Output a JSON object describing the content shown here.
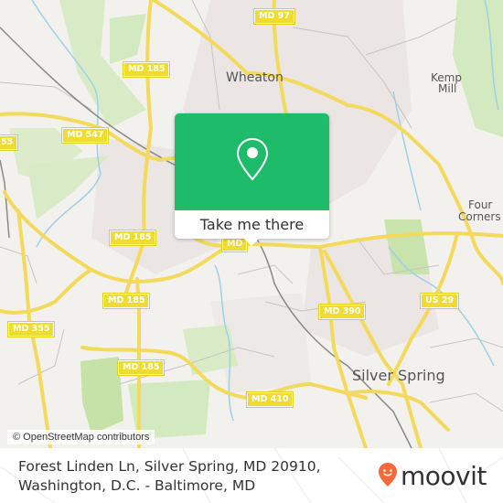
{
  "map": {
    "road_shields": [
      {
        "id": "md97",
        "label": "MD 97"
      },
      {
        "id": "md185-a",
        "label": "MD 185"
      },
      {
        "id": "md547",
        "label": "MD 547"
      },
      {
        "id": "md355-top",
        "label": "55"
      },
      {
        "id": "md185-b",
        "label": "MD 185"
      },
      {
        "id": "md185-c",
        "label": "MD 185"
      },
      {
        "id": "md355",
        "label": "MD 355"
      },
      {
        "id": "md185-d",
        "label": "MD 185"
      },
      {
        "id": "md390",
        "label": "MD 390"
      },
      {
        "id": "us29",
        "label": "US 29"
      },
      {
        "id": "md410",
        "label": "MD 410"
      },
      {
        "id": "md-partial",
        "label": "MD"
      }
    ],
    "places": [
      {
        "id": "wheaton",
        "label": "Wheaton"
      },
      {
        "id": "kemp-mill-1",
        "label": "Kemp"
      },
      {
        "id": "kemp-mill-2",
        "label": "Mill"
      },
      {
        "id": "four-corners-1",
        "label": "Four"
      },
      {
        "id": "four-corners-2",
        "label": "Corners"
      },
      {
        "id": "silver-spring",
        "label": "Silver Spring"
      }
    ],
    "attribution": "© OpenStreetMap contributors",
    "colors": {
      "land": "#f2f1ee",
      "park": "#cfe6b4",
      "residential": "#e9e4e2",
      "road_major": "#f6e27a",
      "water": "#9fd0e8"
    }
  },
  "popup": {
    "action_label": "Take me there",
    "icon": "location-pin-icon",
    "color": "#1ebb6a"
  },
  "footer": {
    "address_line1": "Forest Linden Ln, Silver Spring, MD 20910,",
    "address_line2": "Washington, D.C. - Baltimore, MD",
    "brand": "moovit",
    "brand_color": "#f26a3b"
  }
}
